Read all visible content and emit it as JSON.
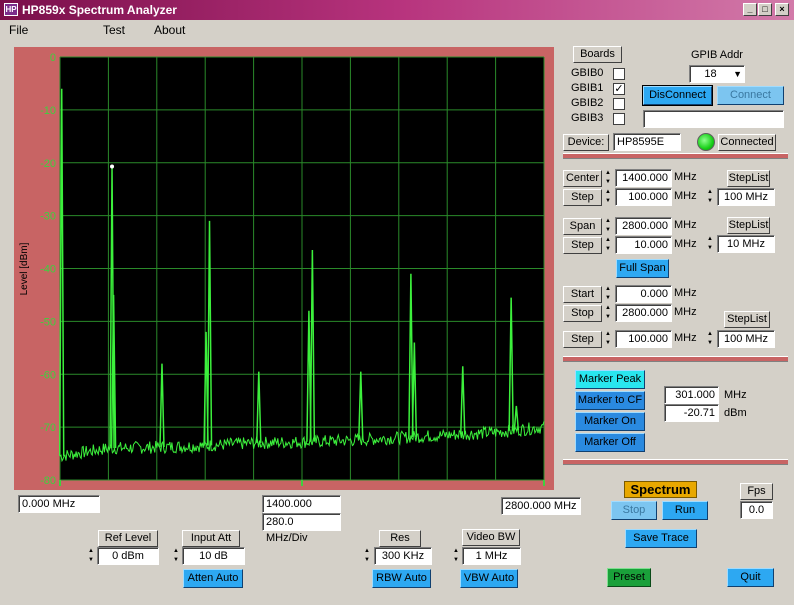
{
  "window": {
    "title": "HP859x Spectrum Analyzer",
    "icon_text": "HP"
  },
  "menu": {
    "file": "File",
    "test": "Test",
    "about": "About"
  },
  "plot": {
    "ylabel": "Level [dBm]",
    "ytick_labels": [
      "0",
      "-10",
      "-20",
      "-30",
      "-40",
      "-50",
      "-60",
      "-70",
      "-80"
    ],
    "start_freq": "0.000 MHz",
    "center_freq": "1400.000 MHz",
    "div_text": "280.0 MHz/Div",
    "stop_freq": "2800.000 MHz"
  },
  "chart_data": {
    "type": "line",
    "xlim": [
      0,
      2800
    ],
    "ylim": [
      -80,
      0
    ],
    "ylabel": "Level [dBm]",
    "grid": true,
    "noise_floor": [
      [
        0,
        -75.5
      ],
      [
        280,
        -74
      ],
      [
        560,
        -73.8
      ],
      [
        840,
        -73.5
      ],
      [
        1120,
        -73
      ],
      [
        1400,
        -72.8
      ],
      [
        1680,
        -72.5
      ],
      [
        1960,
        -72
      ],
      [
        2240,
        -71.5
      ],
      [
        2520,
        -71
      ],
      [
        2800,
        -70
      ]
    ],
    "peaks": [
      {
        "x": 10,
        "y": -6
      },
      {
        "x": 301,
        "y": -20.71
      },
      {
        "x": 310,
        "y": -45
      },
      {
        "x": 590,
        "y": -58
      },
      {
        "x": 845,
        "y": -52
      },
      {
        "x": 865,
        "y": -31
      },
      {
        "x": 1150,
        "y": -59.5
      },
      {
        "x": 1440,
        "y": -48
      },
      {
        "x": 1460,
        "y": -36.5
      },
      {
        "x": 1740,
        "y": -59.5
      },
      {
        "x": 2030,
        "y": -41
      },
      {
        "x": 2050,
        "y": -54
      },
      {
        "x": 2330,
        "y": -58.5
      },
      {
        "x": 2610,
        "y": -45.5
      },
      {
        "x": 2640,
        "y": -66
      }
    ],
    "marker": {
      "x": 301,
      "y": -20.71
    }
  },
  "gpib": {
    "boards_label": "Boards",
    "addr_label": "GPIB Addr",
    "addr_value": "18",
    "boards": [
      {
        "label": "GBIB0",
        "checked": ""
      },
      {
        "label": "GBIB1",
        "checked": "✓"
      },
      {
        "label": "GBIB2",
        "checked": ""
      },
      {
        "label": "GBIB3",
        "checked": ""
      }
    ],
    "disconnect": "DisConnect",
    "connect": "Connect",
    "status_text": "",
    "device_label": "Device:",
    "device_value": "HP8595E",
    "connected": "Connected"
  },
  "freq": {
    "center_label": "Center",
    "center_value": "1400.000",
    "center_step_label": "Step",
    "center_step_value": "100.000",
    "span_label": "Span",
    "span_value": "2800.000",
    "span_step_label": "Step",
    "span_step_value": "10.000",
    "full_span": "Full Span",
    "start_label": "Start",
    "start_value": "0.000",
    "stop_label": "Stop",
    "stop_value": "2800.000",
    "ss_step_label": "Step",
    "ss_step_value": "100.000",
    "unit": "MHz",
    "steplist_label": "StepList",
    "steplist1": "100 MHz",
    "steplist2": "10 MHz",
    "steplist3": "100 MHz"
  },
  "marker": {
    "peak": "Marker Peak",
    "to_cf": "Marker to CF",
    "on": "Marker On",
    "off": "Marker Off",
    "freq_value": "301.000",
    "freq_unit": "MHz",
    "level_value": "-20.71",
    "level_unit": "dBm"
  },
  "run": {
    "spectrum": "Spectrum",
    "stop": "Stop",
    "run": "Run",
    "fps_label": "Fps",
    "fps_value": "0.0",
    "save_trace": "Save Trace",
    "preset": "Preset",
    "quit": "Quit"
  },
  "bottom": {
    "ref_label": "Ref Level",
    "ref_value": "0 dBm",
    "att_label": "Input Att",
    "att_value": "10 dB",
    "atten_auto": "Atten Auto",
    "rbw_label": "Res BW",
    "rbw_value": "300 KHz",
    "rbw_auto": "RBW Auto",
    "vbw_label": "Video BW",
    "vbw_value": "1 MHz",
    "vbw_auto": "VBW Auto"
  }
}
